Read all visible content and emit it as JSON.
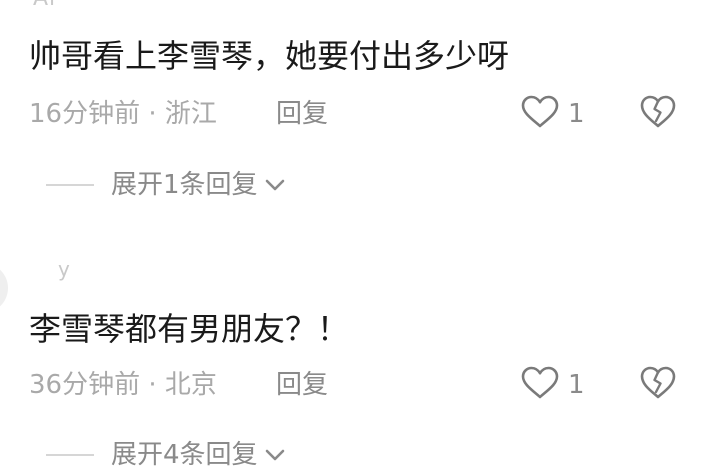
{
  "comments": [
    {
      "text": "帅哥看上李雪琴，她要付出多少呀",
      "meta": "16分钟前 · 浙江",
      "reply_label": "回复",
      "likes": "1",
      "expand_label": "展开1条回复"
    },
    {
      "text": "李雪琴都有男朋友？！",
      "meta": "36分钟前 · 北京",
      "reply_label": "回复",
      "likes": "1",
      "expand_label": "展开4条回复"
    }
  ],
  "icons": {
    "like": "heart-outline-icon",
    "dislike": "broken-heart-icon",
    "expand": "chevron-down-icon"
  },
  "colors": {
    "text_primary": "#1a1a1a",
    "text_meta": "#a9a9a9",
    "text_action": "#8a8a8a",
    "icon": "#7a7a7a"
  }
}
